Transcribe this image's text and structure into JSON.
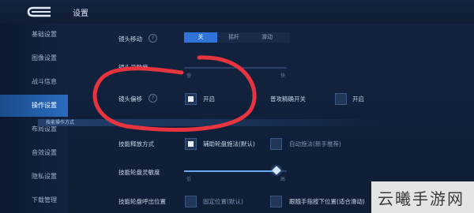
{
  "header": {
    "title": "设置"
  },
  "sidebar": {
    "items": [
      {
        "label": "基础设置"
      },
      {
        "label": "图像设置"
      },
      {
        "label": "战斗信息"
      },
      {
        "label": "操作设置",
        "active": true
      },
      {
        "label": "布局设置"
      },
      {
        "label": "音效设置"
      },
      {
        "label": "隐私设置"
      },
      {
        "label": "下载管理"
      }
    ]
  },
  "settings": {
    "camera_move": {
      "label": "镜头移动",
      "help": "?",
      "options": [
        "关",
        "摇杆",
        "滑动"
      ],
      "selected": "关"
    },
    "camera_sensitivity": {
      "label": "镜头灵敏度",
      "min_label": "慢",
      "max_label": "快"
    },
    "camera_offset": {
      "label": "镜头偏移",
      "help": "?",
      "option": "开启",
      "checked": true
    },
    "precise_aim": {
      "label": "普攻精确开关",
      "option": "开启",
      "checked": false
    },
    "section_title": "技能操作方式",
    "skill_cast": {
      "label": "技能释放方式",
      "option1": "辅助轮盘施法(默认)",
      "option1_checked": true,
      "option2": "自动施法(新手推荐)",
      "option2_checked": false
    },
    "wheel_sensitivity": {
      "label": "技能轮盘灵敏度",
      "min_label": "低",
      "max_label": "高",
      "level": 0.9
    },
    "wheel_position": {
      "label": "技能轮盘呼出位置",
      "option1": "固定位置(默认)",
      "option1_checked": false,
      "option2": "跟随手指按下位置(适合滑动)",
      "option2_checked": false
    }
  },
  "watermark": {
    "text": "云曦手游网"
  },
  "colors": {
    "accent": "#2f72d8",
    "annotation": "#e8343f",
    "background": "#0f1c33"
  }
}
